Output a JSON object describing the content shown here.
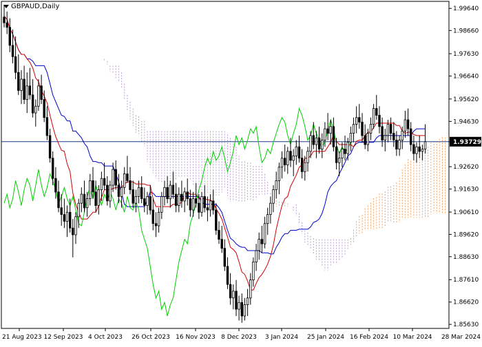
{
  "header": {
    "symbol": "GBPAUD",
    "timeframe": "Daily"
  },
  "colors": {
    "bull": "#000000",
    "bear": "#000000",
    "tenkan": "#d00000",
    "kijun": "#0000c8",
    "chikou": "#00d000",
    "cloud_bull": "#f4a460",
    "cloud_bear": "#b8a0d0",
    "current_price_line": "#1e3c8c"
  },
  "chart_data": {
    "type": "candlestick",
    "indicator": "Ichimoku Kinko Hyo",
    "y_axis_ticks": [
      "1.99640",
      "1.98660",
      "1.97630",
      "1.96640",
      "1.95620",
      "1.94630",
      "1.93729",
      "1.92620",
      "1.91630",
      "1.90610",
      "1.89620",
      "1.88630",
      "1.87610",
      "1.86620",
      "1.85630"
    ],
    "y_axis_tick_values": [
      1.9964,
      1.9866,
      1.9763,
      1.9664,
      1.9562,
      1.9463,
      1.93729,
      1.9262,
      1.9163,
      1.9061,
      1.8962,
      1.8863,
      1.8761,
      1.8662,
      1.8563
    ],
    "x_axis_ticks": [
      "21 Aug 2023",
      "12 Sep 2023",
      "4 Oct 2023",
      "26 Oct 2023",
      "16 Nov 2023",
      "8 Dec 2023",
      "3 Jan 2024",
      "25 Jan 2024",
      "16 Feb 2024",
      "10 Mar 2024",
      "28 Mar 2024"
    ],
    "ylim": [
      1.8545,
      1.9995
    ],
    "current_price": 1.93729,
    "current_price_label": "1.93729",
    "bar_count": 158,
    "cloud_shift": 26,
    "candles": [
      [
        1.9925,
        1.998,
        1.988,
        1.99
      ],
      [
        1.99,
        1.995,
        1.985,
        1.988
      ],
      [
        1.988,
        1.992,
        1.977,
        1.98
      ],
      [
        1.98,
        1.987,
        1.972,
        1.975
      ],
      [
        1.975,
        1.984,
        1.965,
        1.968
      ],
      [
        1.968,
        1.976,
        1.958,
        1.96
      ],
      [
        1.96,
        1.969,
        1.954,
        1.965
      ],
      [
        1.965,
        1.971,
        1.954,
        1.956
      ],
      [
        1.956,
        1.968,
        1.95,
        1.962
      ],
      [
        1.962,
        1.97,
        1.956,
        1.958
      ],
      [
        1.958,
        1.965,
        1.948,
        1.95
      ],
      [
        1.95,
        1.956,
        1.944,
        1.953
      ],
      [
        1.953,
        1.965,
        1.951,
        1.962
      ],
      [
        1.962,
        1.967,
        1.954,
        1.956
      ],
      [
        1.956,
        1.96,
        1.946,
        1.948
      ],
      [
        1.948,
        1.953,
        1.938,
        1.94
      ],
      [
        1.94,
        1.943,
        1.928,
        1.93
      ],
      [
        1.93,
        1.933,
        1.918,
        1.921
      ],
      [
        1.921,
        1.926,
        1.912,
        1.915
      ],
      [
        1.915,
        1.92,
        1.906,
        1.908
      ],
      [
        1.908,
        1.914,
        1.9,
        1.905
      ],
      [
        1.905,
        1.912,
        1.899,
        1.902
      ],
      [
        1.902,
        1.909,
        1.895,
        1.906
      ],
      [
        1.906,
        1.912,
        1.897,
        1.899
      ],
      [
        1.899,
        1.903,
        1.886,
        1.896
      ],
      [
        1.896,
        1.906,
        1.892,
        1.904
      ],
      [
        1.904,
        1.912,
        1.899,
        1.91
      ],
      [
        1.91,
        1.917,
        1.906,
        1.914
      ],
      [
        1.914,
        1.92,
        1.906,
        1.908
      ],
      [
        1.908,
        1.915,
        1.904,
        1.912
      ],
      [
        1.912,
        1.923,
        1.909,
        1.92
      ],
      [
        1.92,
        1.926,
        1.912,
        1.915
      ],
      [
        1.915,
        1.92,
        1.906,
        1.909
      ],
      [
        1.909,
        1.918,
        1.905,
        1.916
      ],
      [
        1.916,
        1.924,
        1.911,
        1.921
      ],
      [
        1.921,
        1.928,
        1.916,
        1.918
      ],
      [
        1.918,
        1.922,
        1.909,
        1.911
      ],
      [
        1.911,
        1.92,
        1.908,
        1.918
      ],
      [
        1.918,
        1.928,
        1.915,
        1.925
      ],
      [
        1.925,
        1.929,
        1.916,
        1.918
      ],
      [
        1.918,
        1.923,
        1.91,
        1.913
      ],
      [
        1.913,
        1.92,
        1.908,
        1.917
      ],
      [
        1.917,
        1.926,
        1.914,
        1.923
      ],
      [
        1.923,
        1.931,
        1.919,
        1.92
      ],
      [
        1.92,
        1.926,
        1.914,
        1.916
      ],
      [
        1.916,
        1.92,
        1.908,
        1.91
      ],
      [
        1.91,
        1.916,
        1.906,
        1.913
      ],
      [
        1.913,
        1.92,
        1.91,
        1.917
      ],
      [
        1.917,
        1.922,
        1.91,
        1.912
      ],
      [
        1.912,
        1.917,
        1.906,
        1.909
      ],
      [
        1.909,
        1.915,
        1.905,
        1.913
      ],
      [
        1.913,
        1.918,
        1.905,
        1.907
      ],
      [
        1.907,
        1.912,
        1.898,
        1.901
      ],
      [
        1.901,
        1.906,
        1.895,
        1.9
      ],
      [
        1.9,
        1.908,
        1.897,
        1.906
      ],
      [
        1.906,
        1.915,
        1.903,
        1.913
      ],
      [
        1.913,
        1.92,
        1.909,
        1.917
      ],
      [
        1.917,
        1.922,
        1.91,
        1.912
      ],
      [
        1.912,
        1.92,
        1.908,
        1.918
      ],
      [
        1.918,
        1.924,
        1.912,
        1.914
      ],
      [
        1.914,
        1.919,
        1.906,
        1.909
      ],
      [
        1.909,
        1.917,
        1.906,
        1.914
      ],
      [
        1.914,
        1.92,
        1.908,
        1.911
      ],
      [
        1.911,
        1.917,
        1.906,
        1.915
      ],
      [
        1.915,
        1.921,
        1.909,
        1.912
      ],
      [
        1.912,
        1.916,
        1.904,
        1.907
      ],
      [
        1.907,
        1.915,
        1.904,
        1.912
      ],
      [
        1.912,
        1.919,
        1.908,
        1.91
      ],
      [
        1.91,
        1.914,
        1.903,
        1.906
      ],
      [
        1.906,
        1.915,
        1.904,
        1.913
      ],
      [
        1.913,
        1.918,
        1.906,
        1.908
      ],
      [
        1.908,
        1.913,
        1.902,
        1.907
      ],
      [
        1.907,
        1.914,
        1.904,
        1.911
      ],
      [
        1.911,
        1.916,
        1.905,
        1.907
      ],
      [
        1.907,
        1.91,
        1.896,
        1.898
      ],
      [
        1.898,
        1.902,
        1.892,
        1.894
      ],
      [
        1.894,
        1.9,
        1.888,
        1.89
      ],
      [
        1.89,
        1.894,
        1.88,
        1.882
      ],
      [
        1.882,
        1.886,
        1.872,
        1.874
      ],
      [
        1.874,
        1.879,
        1.865,
        1.868
      ],
      [
        1.868,
        1.874,
        1.863,
        1.871
      ],
      [
        1.871,
        1.876,
        1.86,
        1.863
      ],
      [
        1.863,
        1.869,
        1.858,
        1.866
      ],
      [
        1.866,
        1.87,
        1.857,
        1.86
      ],
      [
        1.86,
        1.868,
        1.858,
        1.865
      ],
      [
        1.865,
        1.872,
        1.86,
        1.868
      ],
      [
        1.868,
        1.879,
        1.865,
        1.876
      ],
      [
        1.876,
        1.886,
        1.873,
        1.884
      ],
      [
        1.884,
        1.892,
        1.88,
        1.889
      ],
      [
        1.889,
        1.897,
        1.885,
        1.894
      ],
      [
        1.894,
        1.9,
        1.888,
        1.892
      ],
      [
        1.892,
        1.904,
        1.89,
        1.901
      ],
      [
        1.901,
        1.908,
        1.896,
        1.905
      ],
      [
        1.905,
        1.913,
        1.901,
        1.91
      ],
      [
        1.91,
        1.918,
        1.906,
        1.916
      ],
      [
        1.916,
        1.924,
        1.912,
        1.92
      ],
      [
        1.92,
        1.928,
        1.914,
        1.926
      ],
      [
        1.926,
        1.933,
        1.921,
        1.93
      ],
      [
        1.93,
        1.936,
        1.924,
        1.927
      ],
      [
        1.927,
        1.935,
        1.923,
        1.933
      ],
      [
        1.933,
        1.939,
        1.926,
        1.929
      ],
      [
        1.929,
        1.934,
        1.922,
        1.931
      ],
      [
        1.931,
        1.938,
        1.927,
        1.935
      ],
      [
        1.935,
        1.94,
        1.928,
        1.93
      ],
      [
        1.93,
        1.934,
        1.921,
        1.924
      ],
      [
        1.924,
        1.931,
        1.92,
        1.928
      ],
      [
        1.928,
        1.935,
        1.924,
        1.933
      ],
      [
        1.933,
        1.942,
        1.93,
        1.94
      ],
      [
        1.94,
        1.946,
        1.934,
        1.936
      ],
      [
        1.936,
        1.942,
        1.93,
        1.939
      ],
      [
        1.939,
        1.944,
        1.932,
        1.934
      ],
      [
        1.934,
        1.941,
        1.93,
        1.938
      ],
      [
        1.938,
        1.946,
        1.935,
        1.943
      ],
      [
        1.943,
        1.95,
        1.938,
        1.941
      ],
      [
        1.941,
        1.947,
        1.936,
        1.944
      ],
      [
        1.944,
        1.948,
        1.933,
        1.935
      ],
      [
        1.935,
        1.939,
        1.925,
        1.928
      ],
      [
        1.928,
        1.933,
        1.922,
        1.93
      ],
      [
        1.93,
        1.937,
        1.926,
        1.934
      ],
      [
        1.934,
        1.94,
        1.929,
        1.932
      ],
      [
        1.932,
        1.939,
        1.929,
        1.937
      ],
      [
        1.937,
        1.944,
        1.933,
        1.941
      ],
      [
        1.941,
        1.948,
        1.937,
        1.945
      ],
      [
        1.945,
        1.953,
        1.941,
        1.948
      ],
      [
        1.948,
        1.954,
        1.943,
        1.946
      ],
      [
        1.946,
        1.95,
        1.937,
        1.94
      ],
      [
        1.94,
        1.945,
        1.934,
        1.936
      ],
      [
        1.936,
        1.943,
        1.933,
        1.941
      ],
      [
        1.941,
        1.948,
        1.938,
        1.945
      ],
      [
        1.945,
        1.954,
        1.943,
        1.952
      ],
      [
        1.952,
        1.958,
        1.947,
        1.949
      ],
      [
        1.949,
        1.953,
        1.941,
        1.944
      ],
      [
        1.944,
        1.948,
        1.935,
        1.938
      ],
      [
        1.938,
        1.943,
        1.933,
        1.94
      ],
      [
        1.94,
        1.947,
        1.937,
        1.945
      ],
      [
        1.945,
        1.948,
        1.938,
        1.941
      ],
      [
        1.941,
        1.946,
        1.935,
        1.938
      ],
      [
        1.938,
        1.942,
        1.931,
        1.934
      ],
      [
        1.934,
        1.94,
        1.931,
        1.938
      ],
      [
        1.938,
        1.944,
        1.934,
        1.942
      ],
      [
        1.942,
        1.951,
        1.939,
        1.947
      ],
      [
        1.947,
        1.952,
        1.94,
        1.943
      ],
      [
        1.943,
        1.946,
        1.933,
        1.936
      ],
      [
        1.936,
        1.94,
        1.929,
        1.932
      ],
      [
        1.932,
        1.937,
        1.928,
        1.935
      ],
      [
        1.935,
        1.94,
        1.93,
        1.933
      ],
      [
        1.933,
        1.936,
        1.929,
        1.934
      ],
      [
        1.934,
        1.945,
        1.932,
        1.9373
      ]
    ],
    "series": [
      {
        "name": "Tenkan-sen",
        "indicator_line": "tenkan"
      },
      {
        "name": "Kijun-sen",
        "indicator_line": "kijun"
      },
      {
        "name": "Senkou Span A",
        "indicator_line": "span_a"
      },
      {
        "name": "Senkou Span B",
        "indicator_line": "span_b"
      },
      {
        "name": "Chikou Span",
        "indicator_line": "chikou"
      }
    ]
  }
}
